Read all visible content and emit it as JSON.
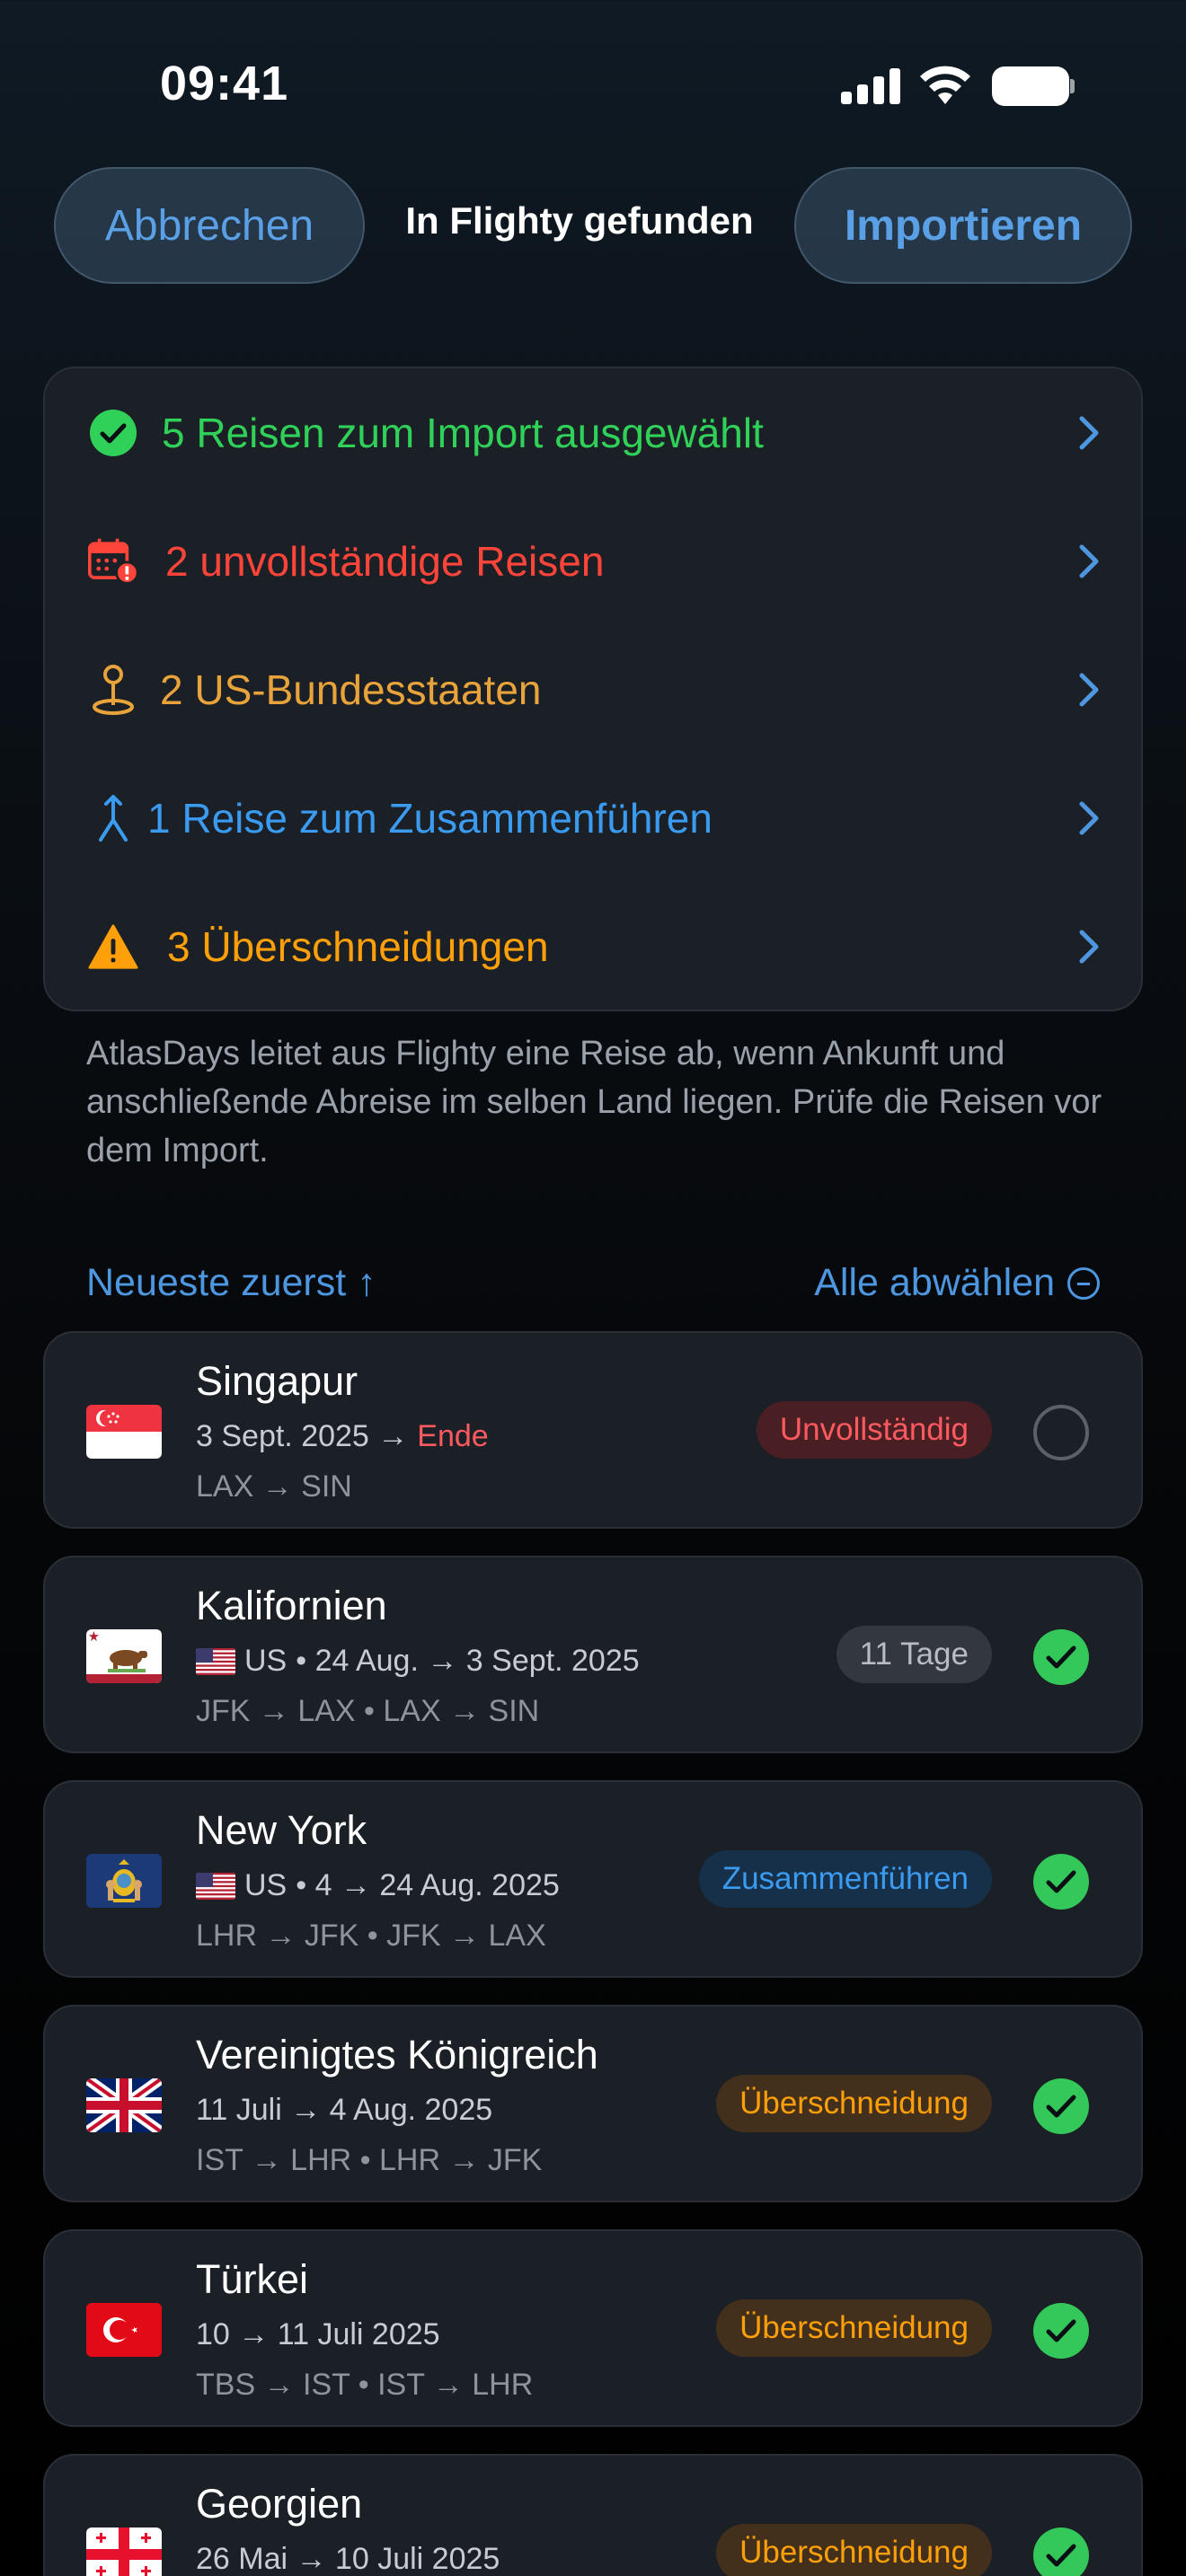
{
  "status": {
    "time": "09:41"
  },
  "nav": {
    "cancel": "Abbrechen",
    "title": "In Flighty gefunden",
    "import": "Importieren"
  },
  "summary": [
    {
      "label": "5 Reisen zum Import ausgewählt",
      "color": "#30d158",
      "icon": "checkmark-circle-icon"
    },
    {
      "label": "2 unvollständige Reisen",
      "color": "#ff453a",
      "icon": "calendar-alert-icon"
    },
    {
      "label": "2 US-Bundesstaaten",
      "color": "#e8a33a",
      "icon": "map-pin-icon"
    },
    {
      "label": "1 Reise zum Zusammenführen",
      "color": "#3a9bf0",
      "icon": "merge-icon"
    },
    {
      "label": "3 Überschneidungen",
      "color": "#ff9f0a",
      "icon": "warning-triangle-icon"
    }
  ],
  "note": "AtlasDays leitet aus Flighty eine Reise ab, wenn Ankunft und anschließende Abreise im selben Land liegen. Prüfe die Reisen vor dem Import.",
  "list": {
    "sort": "Neueste zuerst ↑",
    "deselect": "Alle abwählen"
  },
  "trips": [
    {
      "name": "Singapur",
      "date": "3 Sept. 2025 →",
      "end": "Ende",
      "route": "LAX → SIN",
      "badge": "Unvollständig",
      "badge_color": "#ff5a5f",
      "badge_bg": "#4a1f24",
      "selected": false,
      "flag": "singapore-flag-icon"
    },
    {
      "name": "Kalifornien",
      "prefix": "US",
      "date": "• 24 Aug. → 3 Sept. 2025",
      "route": "JFK → LAX • LAX → SIN",
      "badge": "11 Tage",
      "badge_color": "#b8bcc2",
      "badge_bg": "#33373e",
      "selected": true,
      "flag": "california-flag-icon"
    },
    {
      "name": "New York",
      "prefix": "US",
      "date": "• 4 → 24 Aug. 2025",
      "route": "LHR → JFK • JFK → LAX",
      "badge": "Zusammenführen",
      "badge_color": "#3a9bf0",
      "badge_bg": "#17304a",
      "selected": true,
      "flag": "new-york-flag-icon"
    },
    {
      "name": "Vereinigtes Königreich",
      "date": "11 Juli → 4 Aug. 2025",
      "route": "IST → LHR • LHR → JFK",
      "badge": "Überschneidung",
      "badge_color": "#ff9f0a",
      "badge_bg": "#43301c",
      "selected": true,
      "flag": "uk-flag-icon"
    },
    {
      "name": "Türkei",
      "date": "10 → 11 Juli 2025",
      "route": "TBS → IST • IST → LHR",
      "badge": "Überschneidung",
      "badge_color": "#ff9f0a",
      "badge_bg": "#43301c",
      "selected": true,
      "flag": "turkey-flag-icon"
    },
    {
      "name": "Georgien",
      "date": "26 Mai → 10 Juli 2025",
      "route": "",
      "badge": "Überschneidung",
      "badge_color": "#ff9f0a",
      "badge_bg": "#43301c",
      "selected": true,
      "flag": "georgia-flag-icon"
    }
  ]
}
